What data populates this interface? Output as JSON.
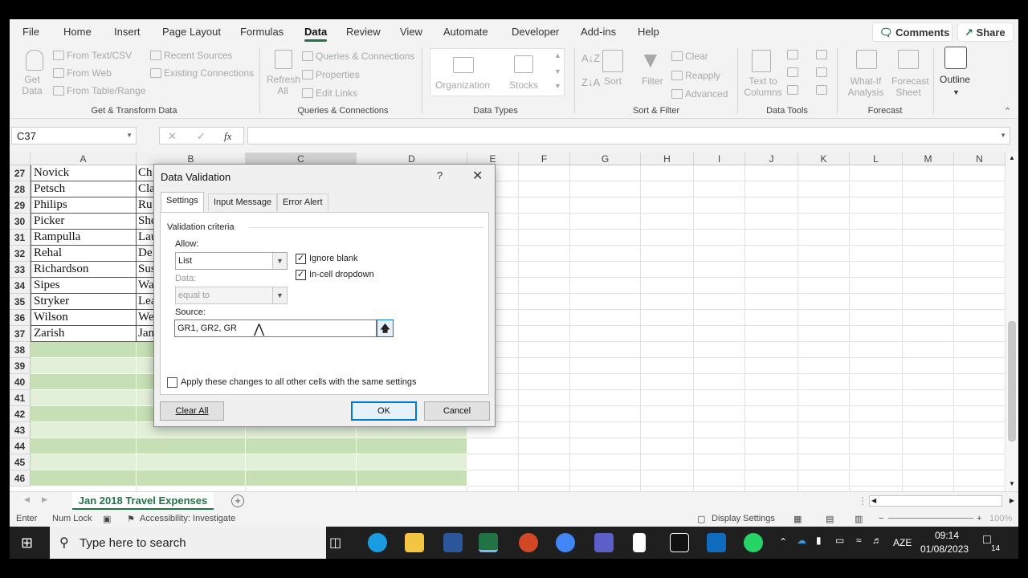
{
  "menu": {
    "tabs": [
      "File",
      "Home",
      "Insert",
      "Page Layout",
      "Formulas",
      "Data",
      "Review",
      "View",
      "Automate",
      "Developer",
      "Add-ins",
      "Help"
    ],
    "active_tab": "Data",
    "comments_label": "Comments",
    "share_label": "Share"
  },
  "ribbon": {
    "get_transform": {
      "get_data": "Get Data",
      "from_text_csv": "From Text/CSV",
      "from_web": "From Web",
      "from_table_range": "From Table/Range",
      "recent_sources": "Recent Sources",
      "existing_connections": "Existing Connections",
      "label": "Get & Transform Data"
    },
    "queries": {
      "refresh_all": "Refresh All",
      "queries_connections": "Queries & Connections",
      "properties": "Properties",
      "edit_links": "Edit Links",
      "label": "Queries & Connections"
    },
    "data_types": {
      "organization": "Organization",
      "stocks": "Stocks",
      "label": "Data Types"
    },
    "sort_filter": {
      "sort": "Sort",
      "filter": "Filter",
      "clear": "Clear",
      "reapply": "Reapply",
      "advanced": "Advanced",
      "label": "Sort & Filter"
    },
    "data_tools": {
      "text_to_columns": "Text to Columns",
      "label": "Data Tools"
    },
    "forecast": {
      "what_if": "What-If Analysis",
      "forecast_sheet": "Forecast Sheet",
      "label": "Forecast"
    },
    "outline": {
      "label": "Outline"
    }
  },
  "formula_bar": {
    "name_box": "C37",
    "cancel_symbol": "✕",
    "confirm_symbol": "✓",
    "fx_symbol": "fx",
    "formula": ""
  },
  "grid": {
    "columns": [
      "A",
      "B",
      "C",
      "D",
      "E",
      "F",
      "G",
      "H",
      "I",
      "J",
      "K",
      "L",
      "M",
      "N"
    ],
    "rows": [
      {
        "num": "27",
        "name": "Novick",
        "b": "Ch"
      },
      {
        "num": "28",
        "name": "Petsch",
        "b": "Cla"
      },
      {
        "num": "29",
        "name": "Philips",
        "b": "Ru"
      },
      {
        "num": "30",
        "name": "Picker",
        "b": "She"
      },
      {
        "num": "31",
        "name": "Rampulla",
        "b": "Lau"
      },
      {
        "num": "32",
        "name": "Rehal",
        "b": "De"
      },
      {
        "num": "33",
        "name": "Richardson",
        "b": "Sus"
      },
      {
        "num": "34",
        "name": "Sipes",
        "b": "Wa"
      },
      {
        "num": "35",
        "name": "Stryker",
        "b": "Lea"
      },
      {
        "num": "36",
        "name": "Wilson",
        "b": "We"
      },
      {
        "num": "37",
        "name": "Zarish",
        "b": "Jan"
      }
    ],
    "empty_rows": [
      "38",
      "39",
      "40",
      "41",
      "42",
      "43",
      "44",
      "45",
      "46"
    ],
    "band_colors": {
      "dark": "#c6dfb4",
      "light": "#e2efd9"
    }
  },
  "sheet": {
    "tab_label": "Jan 2018 Travel Expenses",
    "add_sheet": "+"
  },
  "status": {
    "mode": "Enter",
    "num_lock": "Num Lock",
    "accessibility": "Accessibility: Investigate",
    "display_settings": "Display Settings",
    "zoom": "100%"
  },
  "taskbar": {
    "search_placeholder": "Type here to search",
    "language": "AZE",
    "time": "09:14",
    "date": "01/08/2023",
    "notification_count": "14"
  },
  "dialog": {
    "title": "Data Validation",
    "help": "?",
    "close": "✕",
    "tabs": [
      "Settings",
      "Input Message",
      "Error Alert"
    ],
    "active_tab": "Settings",
    "section_label": "Validation criteria",
    "allow_label": "Allow:",
    "allow_value": "List",
    "data_label": "Data:",
    "data_value": "equal to",
    "ignore_blank_label": "Ignore blank",
    "ignore_blank_checked": true,
    "in_cell_dropdown_label": "In-cell dropdown",
    "in_cell_dropdown_checked": true,
    "source_label": "Source:",
    "source_value": "GR1, GR2, GR",
    "apply_all_label": "Apply these changes to all other cells with the same settings",
    "apply_all_checked": false,
    "clear_all_label": "Clear All",
    "ok_label": "OK",
    "cancel_label": "Cancel"
  },
  "colors": {
    "accent": "#217346",
    "dialog_focus": "#0078d4"
  }
}
